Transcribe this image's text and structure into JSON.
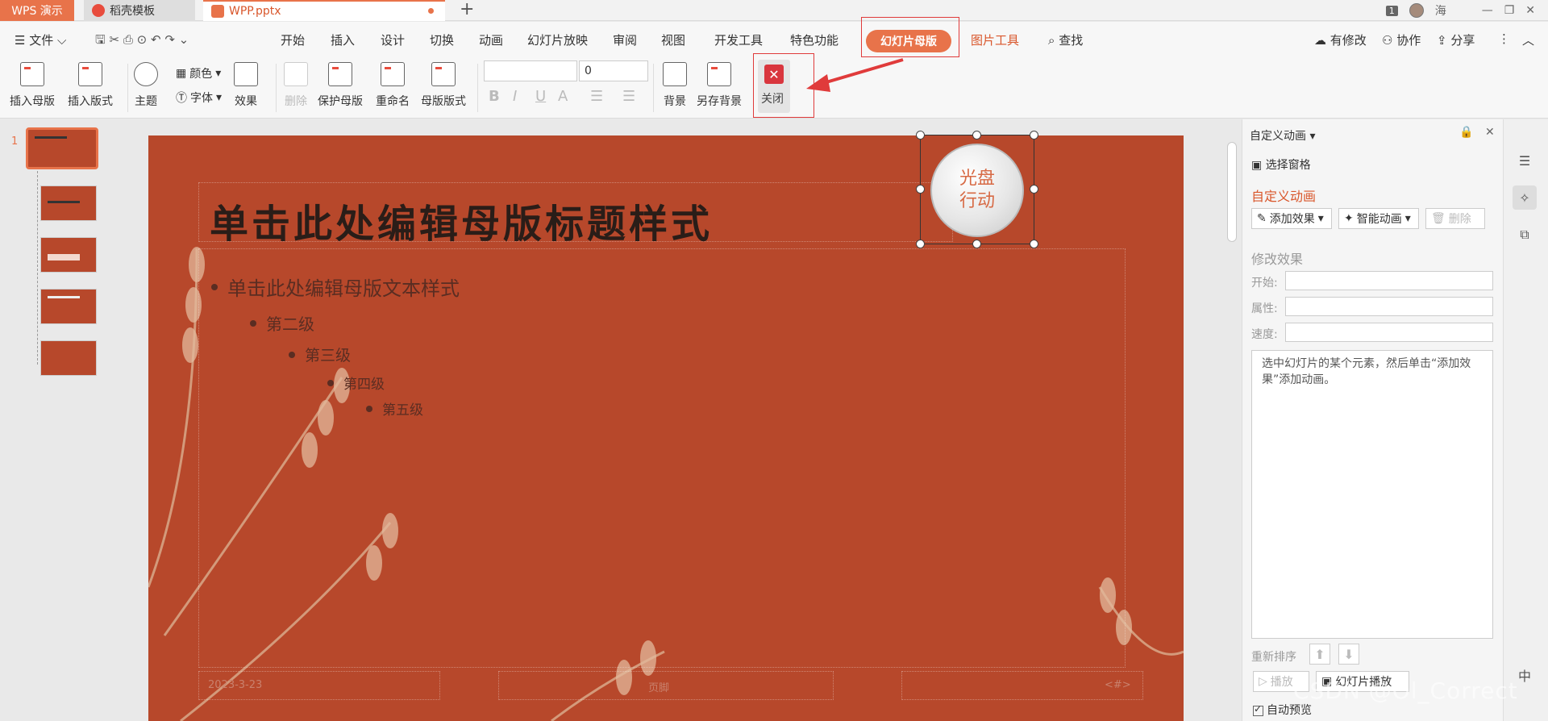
{
  "tabs": {
    "app": "WPS 演示",
    "template": "稻壳模板",
    "file": "WPP.pptx"
  },
  "titlebar": {
    "badge": "1",
    "user": "海"
  },
  "menu": {
    "file": "文件",
    "items": [
      "开始",
      "插入",
      "设计",
      "切换",
      "动画",
      "幻灯片放映",
      "审阅",
      "视图",
      "开发工具",
      "特色功能"
    ],
    "active_tab": "幻灯片母版",
    "picture_tools": "图片工具",
    "search": "查找",
    "modified": "有修改",
    "collab": "协作",
    "share": "分享"
  },
  "ribbon": {
    "insert_master": "插入母版",
    "insert_layout": "插入版式",
    "theme": "主题",
    "color": "颜色",
    "font": "字体",
    "effect": "效果",
    "delete": "删除",
    "protect_master": "保护母版",
    "rename": "重命名",
    "master_layout": "母版版式",
    "font_size": "0",
    "background": "背景",
    "save_background": "另存背景",
    "close": "关闭"
  },
  "slide": {
    "title": "单击此处编辑母版标题样式",
    "level1": "单击此处编辑母版文本样式",
    "level2": "第二级",
    "level3": "第三级",
    "level4": "第四级",
    "level5": "第五级",
    "date": "2023-3-23",
    "footer": "页脚",
    "page": "<#>",
    "seal_line1": "光盘",
    "seal_line2": "行动"
  },
  "thumbnails": {
    "first_number": "1"
  },
  "panel": {
    "header": "自定义动画",
    "select_pane": "选择窗格",
    "section": "自定义动画",
    "add_effect": "添加效果",
    "smart_anim": "智能动画",
    "delete": "删除",
    "modify": "修改效果",
    "start": "开始:",
    "property": "属性:",
    "speed": "速度:",
    "hint": "选中幻灯片的某个元素，然后单击“添加效果”添加动画。",
    "reorder": "重新排序",
    "play": "播放",
    "slideshow": "幻灯片播放",
    "auto_preview": "自动预览"
  },
  "watermark": "CSDN @Ol_Correct",
  "colors": {
    "accent": "#e8734a",
    "slide_bg": "#b7482b",
    "highlight": "#e03b3b"
  }
}
